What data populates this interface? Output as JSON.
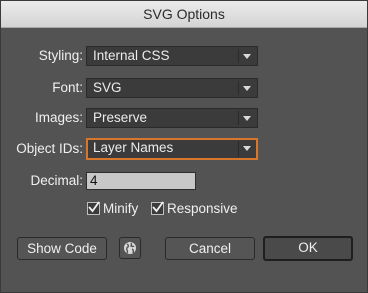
{
  "window": {
    "title": "SVG Options"
  },
  "fields": {
    "styling": {
      "label": "Styling:",
      "value": "Internal CSS"
    },
    "font": {
      "label": "Font:",
      "value": "SVG"
    },
    "images": {
      "label": "Images:",
      "value": "Preserve"
    },
    "object_ids": {
      "label": "Object IDs:",
      "value": "Layer Names"
    },
    "decimal": {
      "label": "Decimal:",
      "value": "4"
    }
  },
  "checkboxes": {
    "minify": {
      "label": "Minify",
      "checked": true
    },
    "responsive": {
      "label": "Responsive",
      "checked": true
    }
  },
  "buttons": {
    "show_code": "Show Code",
    "cancel": "Cancel",
    "ok": "OK"
  },
  "icons": {
    "web": "globe-icon",
    "dropdown": "chevron-down-icon",
    "check": "checkmark-icon"
  },
  "colors": {
    "focus_ring": "#d8762c",
    "background": "#535353"
  }
}
